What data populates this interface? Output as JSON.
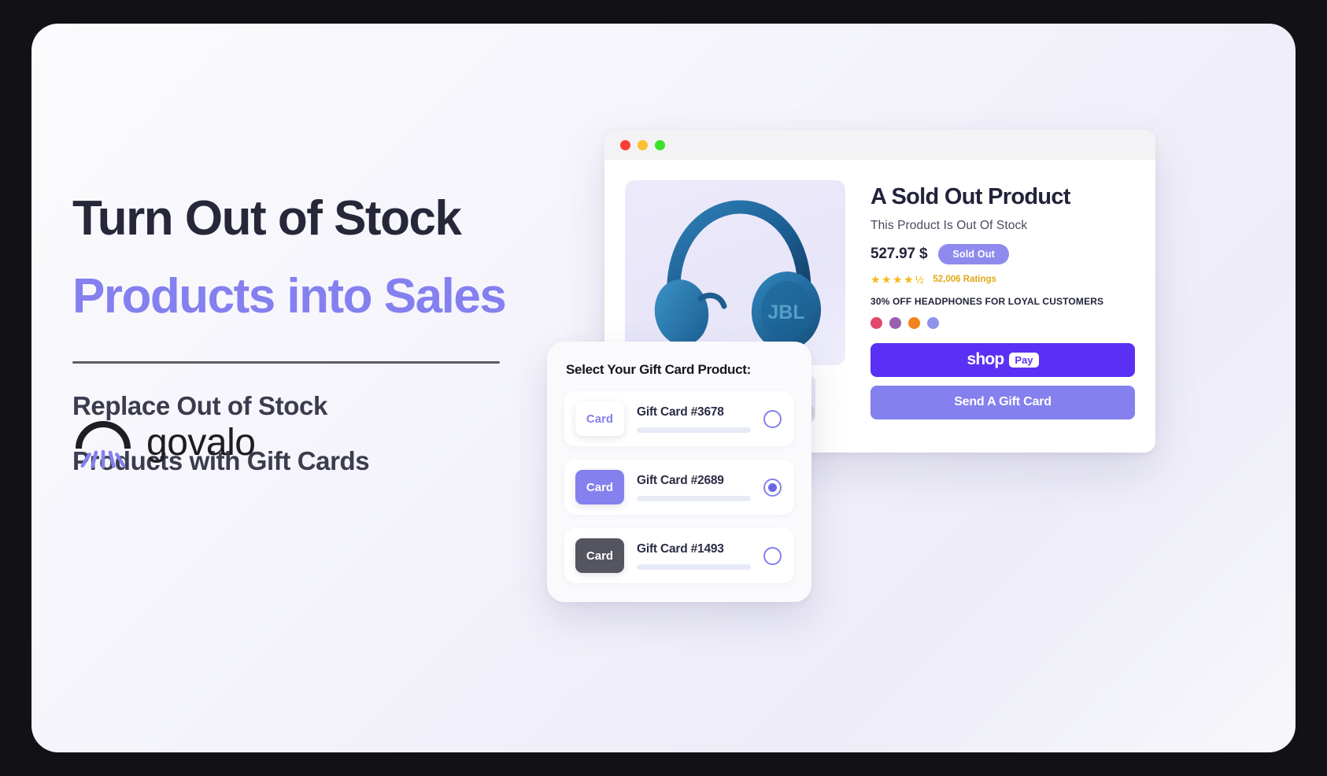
{
  "hero": {
    "headline_line1": "Turn Out of Stock",
    "headline_line2": "Products into Sales",
    "subhead_line1": "Replace Out of Stock",
    "subhead_line2": "Products with Gift Cards",
    "accent_color": "#8480ef",
    "heading_color": "#262739"
  },
  "logo": {
    "wordmark": "govalo",
    "mark_name": "govalo-sunburst-mark",
    "ray_color": "#8480ee",
    "arc_color": "#1d1d22"
  },
  "browser": {
    "traffic_lights": [
      "close",
      "minimize",
      "maximize"
    ],
    "colors": {
      "close": "#fc3f36",
      "minimize": "#fbc02f",
      "maximize": "#3ae22c"
    }
  },
  "product": {
    "title": "A Sold Out Product",
    "subtitle": "This Product Is Out Of Stock",
    "price": "527.97 $",
    "stock_badge": "Sold Out",
    "stock_badge_color": "#8f8bee",
    "stars": "★★★★½",
    "rating_count": "52,006 Ratings",
    "rating_color": "#f6b817",
    "promo": "30% OFF HEADPHONES FOR LOYAL CUSTOMERS",
    "swatches": [
      "#e0476b",
      "#9a5fb0",
      "#f2821c",
      "#8f92ea"
    ],
    "image_alt": "blue-jbl-headphones",
    "thumbnail_alt": "white-headphones-thumbnail",
    "buttons": {
      "shop_pay_word": "shop",
      "shop_pay_pill": "Pay",
      "shop_pay_color": "#5a31f4",
      "gift_card_label": "Send A Gift Card",
      "gift_card_color": "#8480ee"
    }
  },
  "selector": {
    "title": "Select Your Gift Card Product:",
    "options": [
      {
        "chip_label": "Card",
        "chip_style": "light",
        "label": "Gift Card #3678",
        "selected": false
      },
      {
        "chip_label": "Card",
        "chip_style": "purple",
        "label": "Gift Card #2689",
        "selected": true
      },
      {
        "chip_label": "Card",
        "chip_style": "dark",
        "label": "Gift Card #1493",
        "selected": false
      }
    ]
  }
}
